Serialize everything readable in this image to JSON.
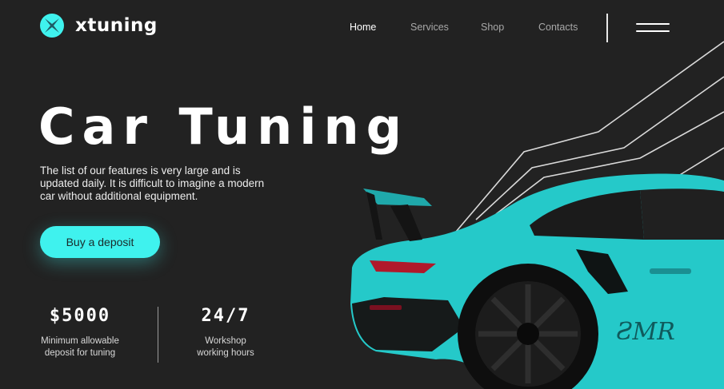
{
  "brand": {
    "name": "xtuning",
    "logo_icon": "x-emblem-icon",
    "accent": "#3ff2ee"
  },
  "nav": {
    "items": [
      {
        "label": "Home",
        "active": true
      },
      {
        "label": "Services",
        "active": false
      },
      {
        "label": "Shop",
        "active": false
      },
      {
        "label": "Contacts",
        "active": false
      }
    ],
    "menu_icon": "hamburger-menu-icon"
  },
  "hero": {
    "title": "Car Tuning",
    "subtitle": "The list of our features is very large and is updated daily. It is difficult to imagine a modern car without additional equipment.",
    "cta_label": "Buy a deposit"
  },
  "stats": [
    {
      "value": "$5000",
      "label": "Minimum allowable\ndeposit for tuning"
    },
    {
      "value": "24/7",
      "label": "Workshop\nworking hours"
    }
  ],
  "colors": {
    "background": "#222222",
    "car_body": "#25c9c9"
  }
}
